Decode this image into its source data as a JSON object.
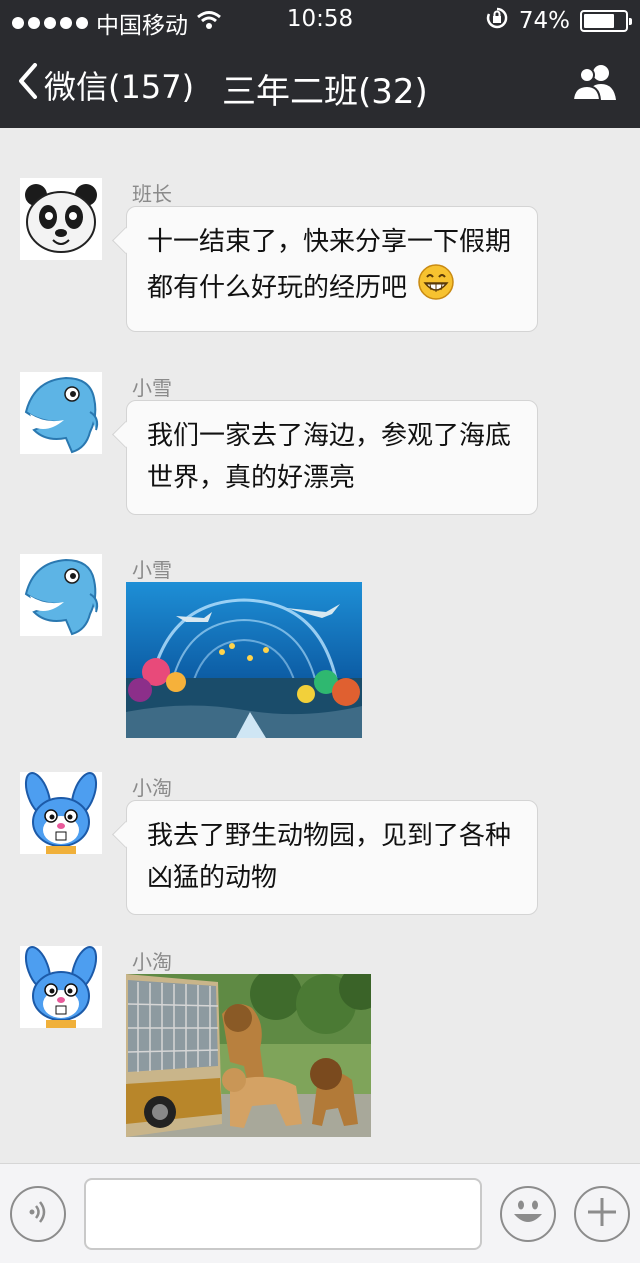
{
  "status_bar": {
    "carrier": "中国移动",
    "time": "10:58",
    "battery": "74%",
    "battery_level": 0.74
  },
  "nav": {
    "back_label": "微信(157)",
    "title": "三年二班(32)"
  },
  "messages": [
    {
      "sender": "班长",
      "type": "text",
      "avatar": "panda-avatar",
      "text": "十一结束了，快来分享一下假期都有什么好玩的经历吧",
      "emoji": "grin-emoji"
    },
    {
      "sender": "小雪",
      "type": "text",
      "avatar": "dolphin-avatar",
      "text": "我们一家去了海边，参观了海底世界，真的好漂亮"
    },
    {
      "sender": "小雪",
      "type": "image",
      "avatar": "dolphin-avatar",
      "image": "aquarium-photo"
    },
    {
      "sender": "小淘",
      "type": "text",
      "avatar": "rabbit-avatar",
      "text": "我去了野生动物园，见到了各种凶猛的动物"
    },
    {
      "sender": "小淘",
      "type": "image",
      "avatar": "rabbit-avatar",
      "image": "lions-bus-photo"
    }
  ],
  "input_bar": {
    "voice_icon": "voice-icon",
    "emoji_icon": "emoji-icon",
    "add_icon": "plus-icon"
  },
  "colors": {
    "header_bg": "#2a2b2f",
    "chat_bg": "#ebebeb",
    "bubble_bg": "#fafafa"
  }
}
